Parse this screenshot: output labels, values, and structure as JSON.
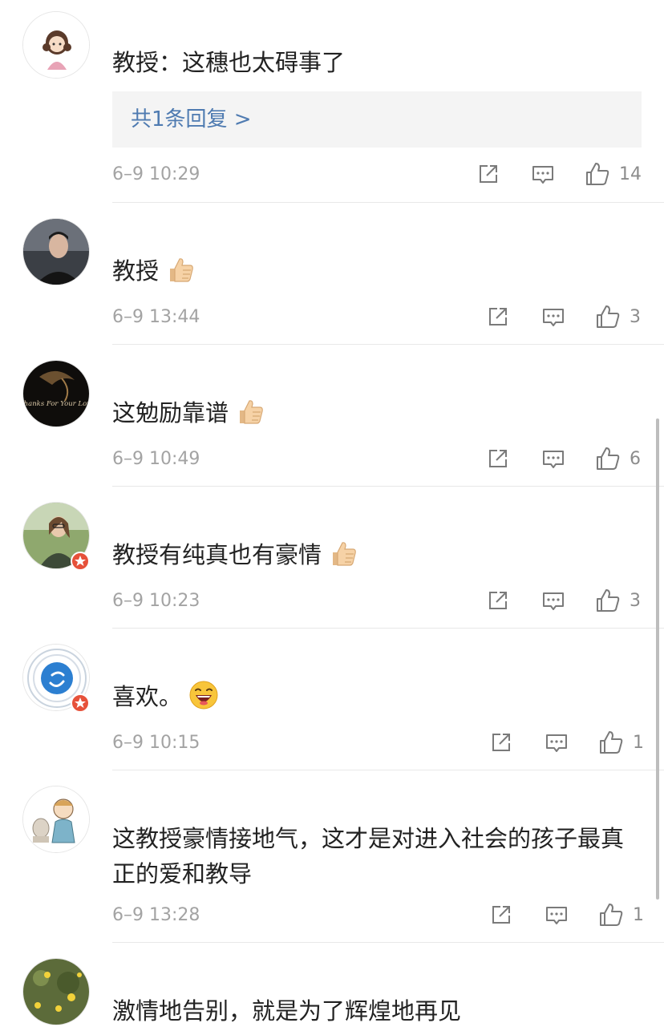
{
  "comments": [
    {
      "text": "教授：这穗也太碍事了",
      "time": "6–9 10:29",
      "likes": "14",
      "reply_link": "共1条回复 >"
    },
    {
      "text": "教授",
      "time": "6–9 13:44",
      "likes": "3",
      "emoji": "thumbs-up"
    },
    {
      "text": "这勉励靠谱",
      "time": "6–9 10:49",
      "likes": "6",
      "emoji": "thumbs-up"
    },
    {
      "text": "教授有纯真也有豪情",
      "time": "6–9 10:23",
      "likes": "3",
      "emoji": "thumbs-up",
      "verified": true
    },
    {
      "text": "喜欢。",
      "time": "6–9 10:15",
      "likes": "1",
      "emoji": "laughing-face",
      "verified": true
    },
    {
      "text": "这教授豪情接地气，这才是对进入社会的孩子最真正的爱和教导",
      "time": "6–9 13:28",
      "likes": "1"
    },
    {
      "text": "激情地告别，就是为了辉煌地再见"
    }
  ],
  "avatar3_text": "Thanks For Your Love",
  "colors": {
    "accent_link": "#4f7bb1",
    "meta_gray": "#a3a3a3",
    "verified_badge": "#e6513a",
    "reply_bg": "#f4f4f4"
  }
}
